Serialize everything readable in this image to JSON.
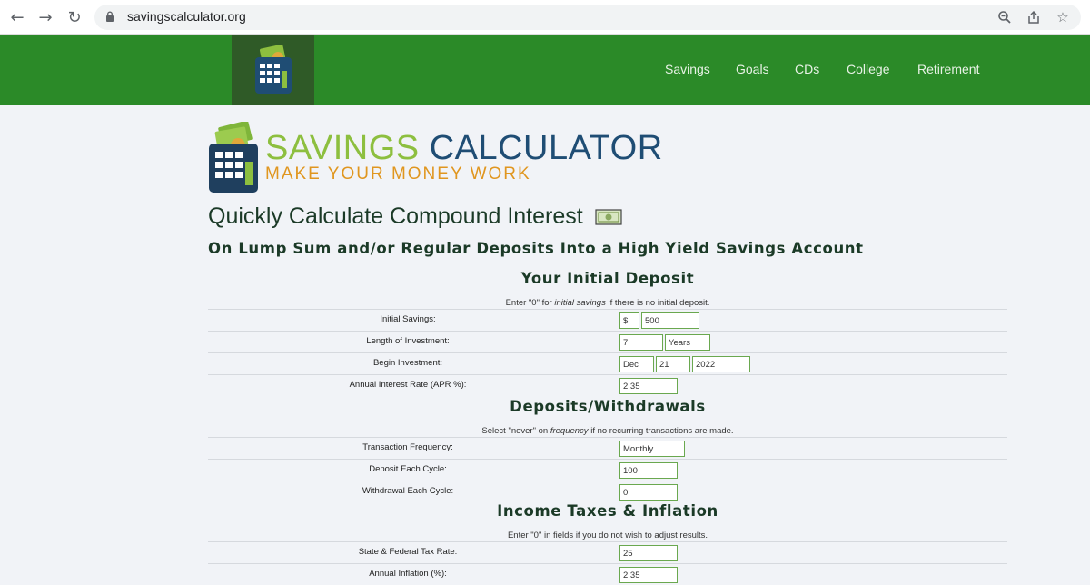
{
  "browser": {
    "url": "savingscalculator.org",
    "back_icon": "arrow-left-icon",
    "forward_icon": "arrow-right-icon",
    "reload_icon": "reload-icon"
  },
  "site_nav": {
    "links": [
      "Savings",
      "Goals",
      "CDs",
      "College",
      "Retirement"
    ]
  },
  "brand": {
    "title_part1": "SAVINGS",
    "title_part2": "CALCULATOR",
    "tagline": "MAKE YOUR MONEY WORK"
  },
  "page": {
    "title": "Quickly Calculate Compound Interest",
    "subtitle": "On Lump Sum and/or Regular Deposits Into a High Yield Savings Account"
  },
  "initial_deposit": {
    "heading": "Your Initial Deposit",
    "note_pre": "Enter \"0\" for ",
    "note_em": "initial savings",
    "note_post": " if there is no initial deposit.",
    "initial_savings_label": "Initial Savings:",
    "currency": "$",
    "initial_savings": "500",
    "length_label": "Length of Investment:",
    "length_value": "7",
    "length_unit": "Years",
    "begin_label": "Begin Investment:",
    "begin_month": "Dec",
    "begin_day": "21",
    "begin_year": "2022",
    "rate_label": "Annual Interest Rate (APR %):",
    "rate_value": "2.35"
  },
  "deposits": {
    "heading": "Deposits/Withdrawals",
    "note_pre": "Select \"never\" on ",
    "note_em": "frequency",
    "note_post": " if no recurring transactions are made.",
    "frequency_label": "Transaction Frequency:",
    "frequency_value": "Monthly",
    "deposit_label": "Deposit Each Cycle:",
    "deposit_value": "100",
    "withdrawal_label": "Withdrawal Each Cycle:",
    "withdrawal_value": "0"
  },
  "taxes": {
    "heading": "Income Taxes & Inflation",
    "note": "Enter \"0\" in fields if you do not wish to adjust results.",
    "tax_label": "State & Federal Tax Rate:",
    "tax_value": "25",
    "inflation_label": "Annual Inflation (%):",
    "inflation_value": "2.35"
  },
  "colors": {
    "header_green": "#2b8a28",
    "logo_dark_green": "#2f5a27",
    "brand_light_green": "#8dbf3f",
    "brand_navy": "#1f4d74",
    "tagline_orange": "#e0961f",
    "field_border": "#6aa84f"
  }
}
